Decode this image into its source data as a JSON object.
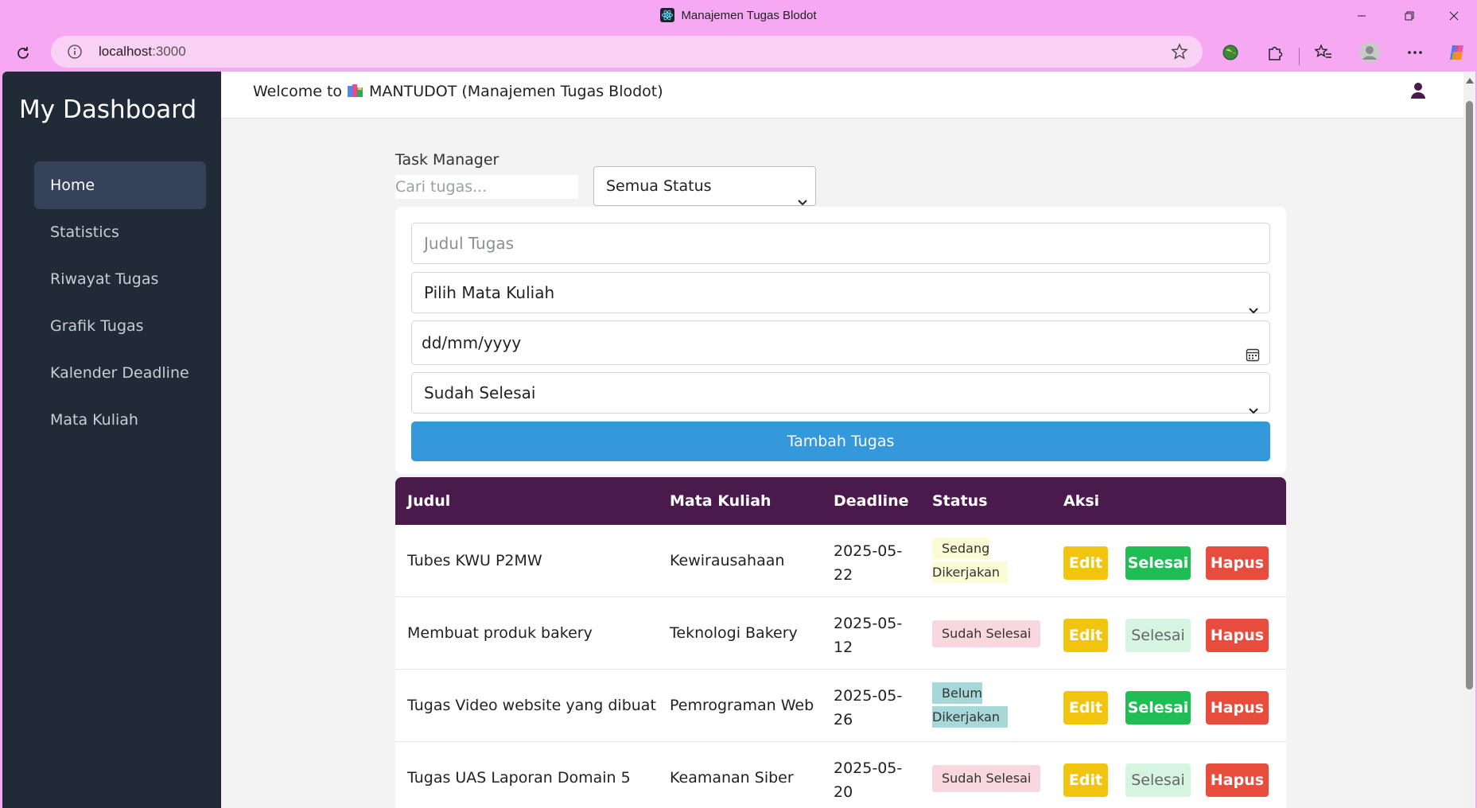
{
  "browser": {
    "window_title": "Manajemen Tugas Blodot",
    "url_host": "localhost",
    "url_port": ":3000"
  },
  "sidebar": {
    "brand": "My Dashboard",
    "items": [
      {
        "label": "Home",
        "active": true
      },
      {
        "label": "Statistics"
      },
      {
        "label": "Riwayat Tugas"
      },
      {
        "label": "Grafik Tugas"
      },
      {
        "label": "Kalender Deadline"
      },
      {
        "label": "Mata Kuliah"
      }
    ]
  },
  "topbar": {
    "welcome_prefix": "Welcome to",
    "welcome_app": "MANTUDOT (Manajemen Tugas Blodot)"
  },
  "task_manager": {
    "heading": "Task Manager",
    "search_placeholder": "Cari tugas...",
    "status_filter": "Semua Status"
  },
  "form": {
    "title_placeholder": "Judul Tugas",
    "course_select": "Pilih Mata Kuliah",
    "date_placeholder": "dd/mm/yyyy",
    "status_select": "Sudah Selesai",
    "submit_label": "Tambah Tugas"
  },
  "table": {
    "headers": [
      "Judul",
      "Mata Kuliah",
      "Deadline",
      "Status",
      "Aksi"
    ],
    "action_labels": {
      "edit": "Edit",
      "done": "Selesai",
      "delete": "Hapus"
    },
    "rows": [
      {
        "title": "Tubes KWU P2MW",
        "course": "Kewirausahaan",
        "deadline_1": "2025-05-",
        "deadline_2": "22",
        "status_1": "Sedang",
        "status_2": "Dikerjakan",
        "status_kind": "sedang"
      },
      {
        "title": "Membuat produk bakery",
        "course": "Teknologi Bakery",
        "deadline_1": "2025-05-",
        "deadline_2": "12",
        "status_1": "Sudah Selesai",
        "status_2": "",
        "status_kind": "sudah"
      },
      {
        "title": "Tugas Video website yang dibuat",
        "course": "Pemrograman Web",
        "deadline_1": "2025-05-",
        "deadline_2": "26",
        "status_1": "Belum",
        "status_2": "Dikerjakan",
        "status_kind": "belum"
      },
      {
        "title": "Tugas UAS Laporan Domain 5",
        "course": "Keamanan Siber",
        "deadline_1": "2025-05-",
        "deadline_2": "20",
        "status_1": "Sudah Selesai",
        "status_2": "",
        "status_kind": "sudah"
      }
    ]
  },
  "colors": {
    "browser_frame": "#f6a9f2",
    "sidebar": "#212b38",
    "table_header": "#4a1a4d",
    "primary_button": "#3498db",
    "edit": "#f1c40f",
    "done": "#1fbe55",
    "delete": "#e74c3c"
  }
}
